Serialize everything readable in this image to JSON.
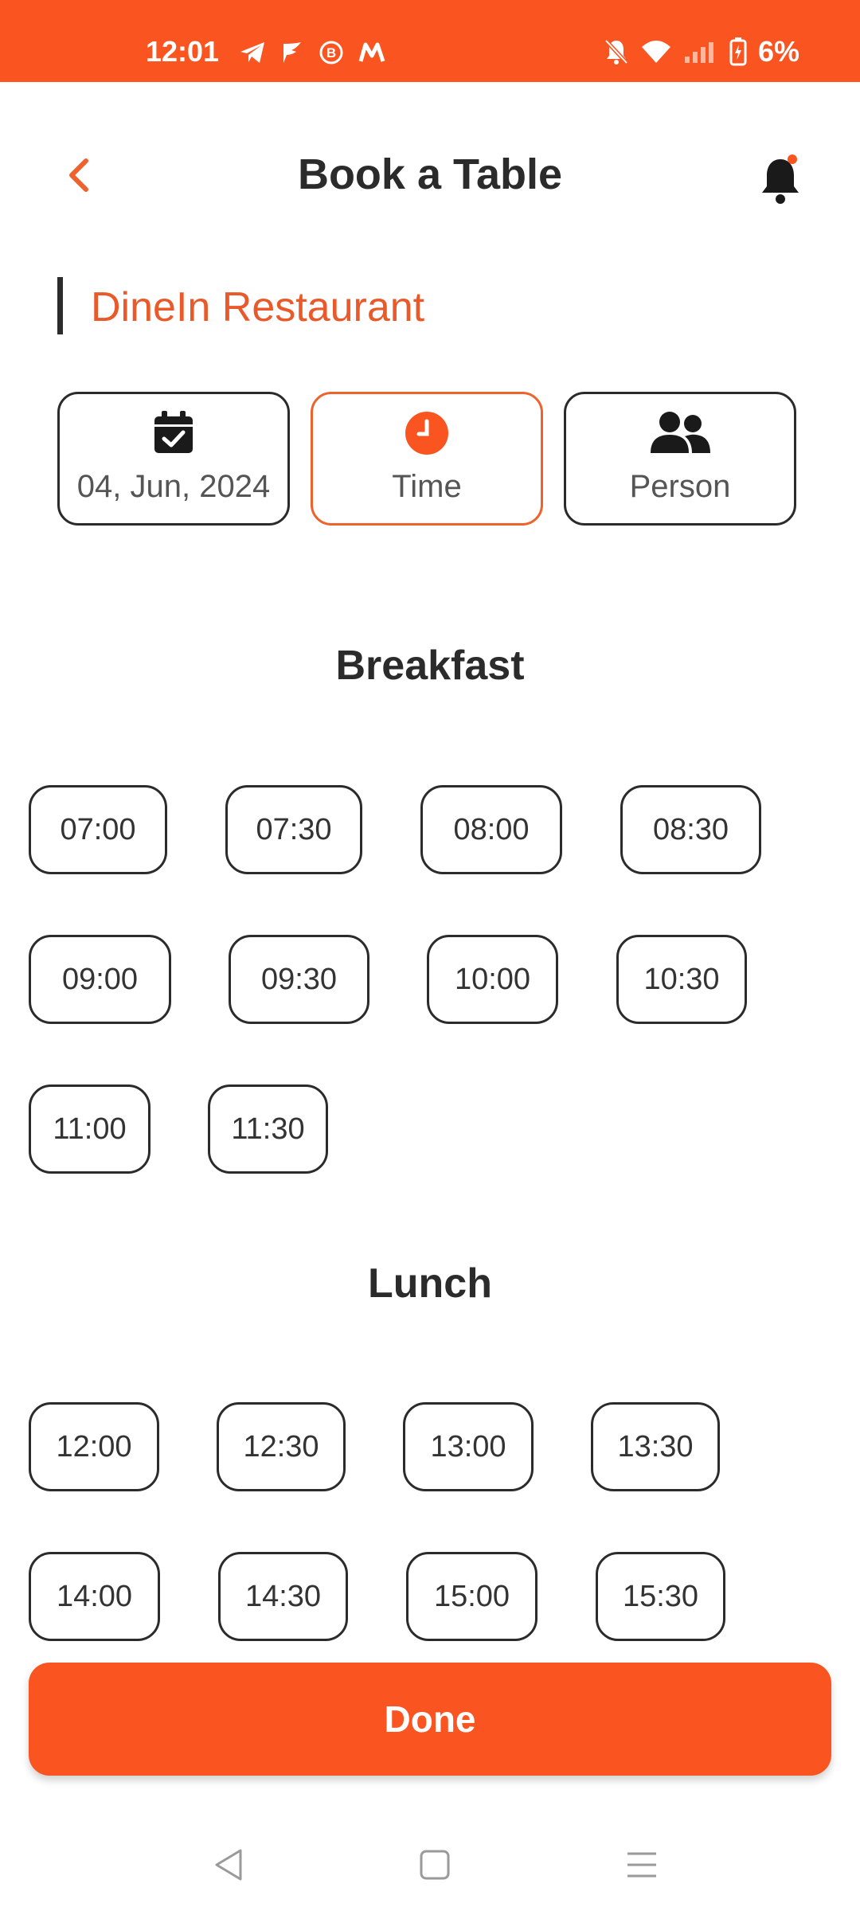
{
  "status_bar": {
    "time": "12:01",
    "left_icons": [
      "telegram-icon",
      "feather-icon",
      "b-badge-icon",
      "m-logo-icon"
    ],
    "right_icons": [
      "mute-bell-icon",
      "wifi-icon",
      "signal-icon",
      "battery-icon"
    ],
    "battery": "6%"
  },
  "header": {
    "title": "Book a Table",
    "back_icon": "chevron-left-icon",
    "notification_icon": "bell-icon"
  },
  "restaurant": {
    "name": "DineIn Restaurant"
  },
  "selectors": [
    {
      "label": "04, Jun, 2024",
      "icon": "calendar-check-icon",
      "active": false
    },
    {
      "label": "Time",
      "icon": "clock-icon",
      "active": true
    },
    {
      "label": "Person",
      "icon": "people-icon",
      "active": false
    }
  ],
  "sections": {
    "breakfast": {
      "title": "Breakfast",
      "slots": [
        "07:00",
        "07:30",
        "08:00",
        "08:30",
        "09:00",
        "09:30",
        "10:00",
        "10:30",
        "11:00",
        "11:30"
      ]
    },
    "lunch": {
      "title": "Lunch",
      "slots": [
        "12:00",
        "12:30",
        "13:00",
        "13:30",
        "14:00",
        "14:30",
        "15:00",
        "15:30"
      ]
    }
  },
  "done_button": {
    "label": "Done"
  },
  "nav_bar": {
    "icons": [
      "back-triangle-icon",
      "home-square-icon",
      "menu-lines-icon"
    ]
  },
  "colors": {
    "accent": "#fa5420",
    "text": "#2b2b2b",
    "restaurant_name": "#e9592a"
  }
}
